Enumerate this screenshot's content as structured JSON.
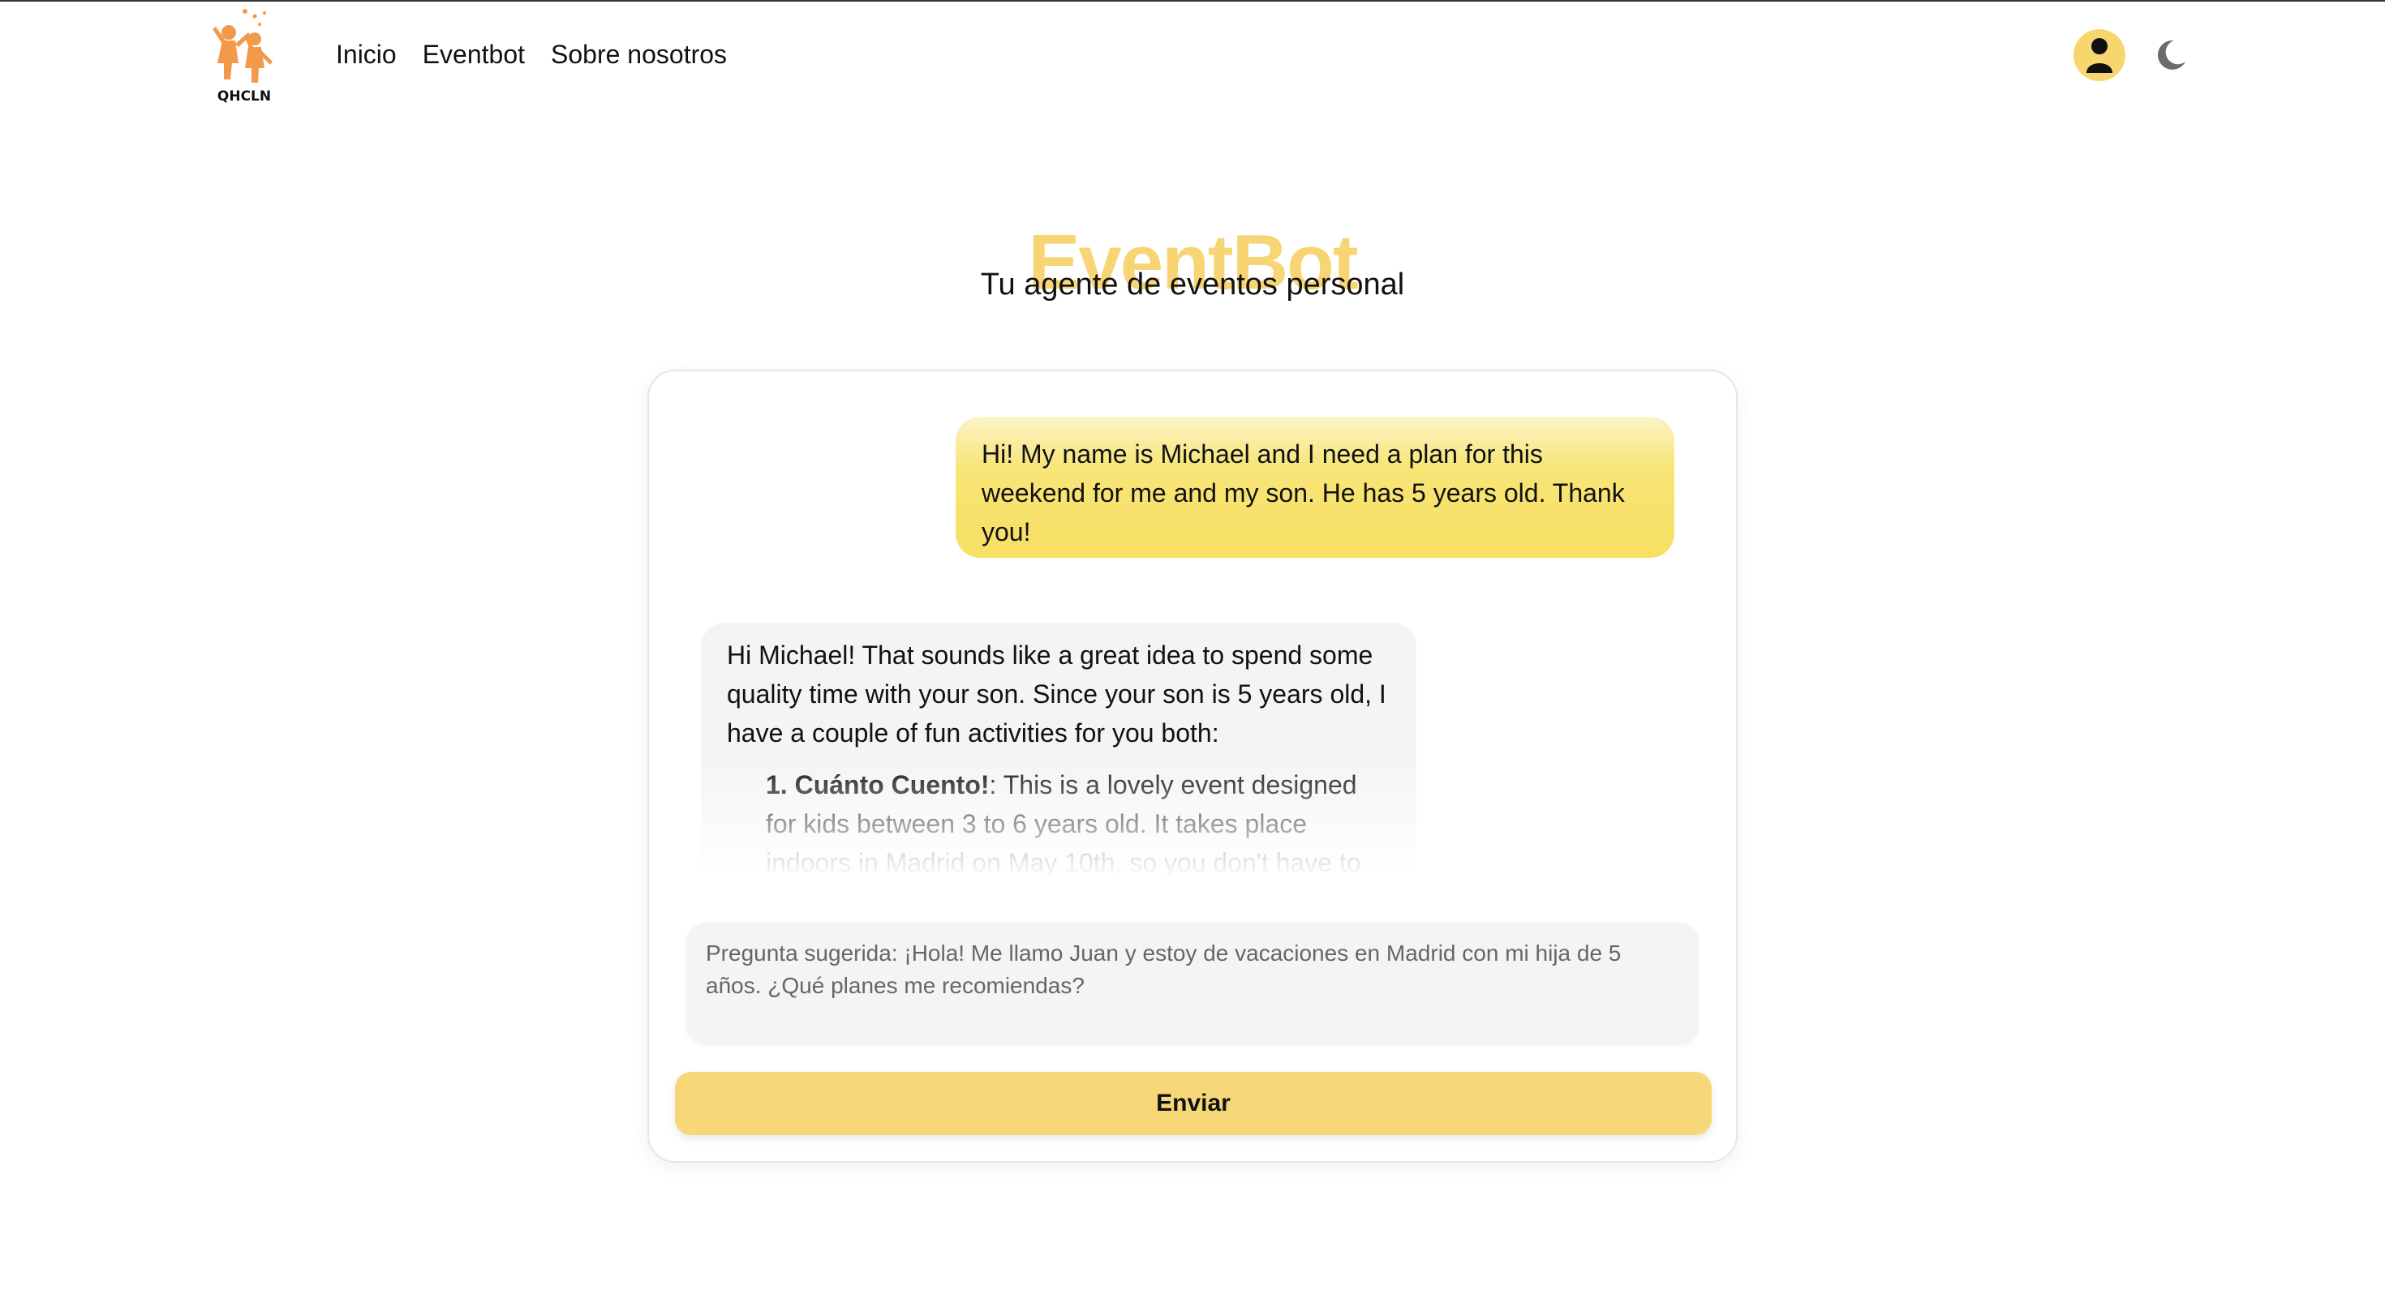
{
  "navbar": {
    "logo_text": "QHCLN",
    "links": [
      "Inicio",
      "Eventbot",
      "Sobre nosotros"
    ]
  },
  "hero": {
    "title": "EventBot",
    "subtitle": "Tu agente de eventos personal"
  },
  "chat": {
    "messages": [
      {
        "role": "user",
        "text": "Hi! My name is Michael and I need a plan for this weekend for me and my son. He has 5 years old. Thank you!"
      },
      {
        "role": "bot",
        "intro": "Hi Michael! That sounds like a great idea to spend some quality time with your son. Since your son is 5 years old, I have a couple of fun activities for you both:",
        "items": [
          {
            "number": "1.",
            "title": "Cuánto Cuento!",
            "text": ": This is a lovely event designed for kids between 3 to 6 years old. It takes place indoors in Madrid on May 10th, so you don't have to"
          }
        ]
      }
    ],
    "input_placeholder": "Pregunta sugerida: ¡Hola! Me llamo Juan y estoy de vacaciones en Madrid con mi hija de 5 años. ¿Qué planes me recomiendas?",
    "input_value": "",
    "send_label": "Enviar"
  },
  "icons": {
    "user": "user-avatar-icon",
    "theme_toggle": "moon-icon"
  },
  "colors": {
    "accent": "#f7d574",
    "user_bubble": "#f7df62",
    "bot_bubble": "#f3f4f6",
    "button": "#f7d878",
    "logo": "#f29a4a"
  }
}
